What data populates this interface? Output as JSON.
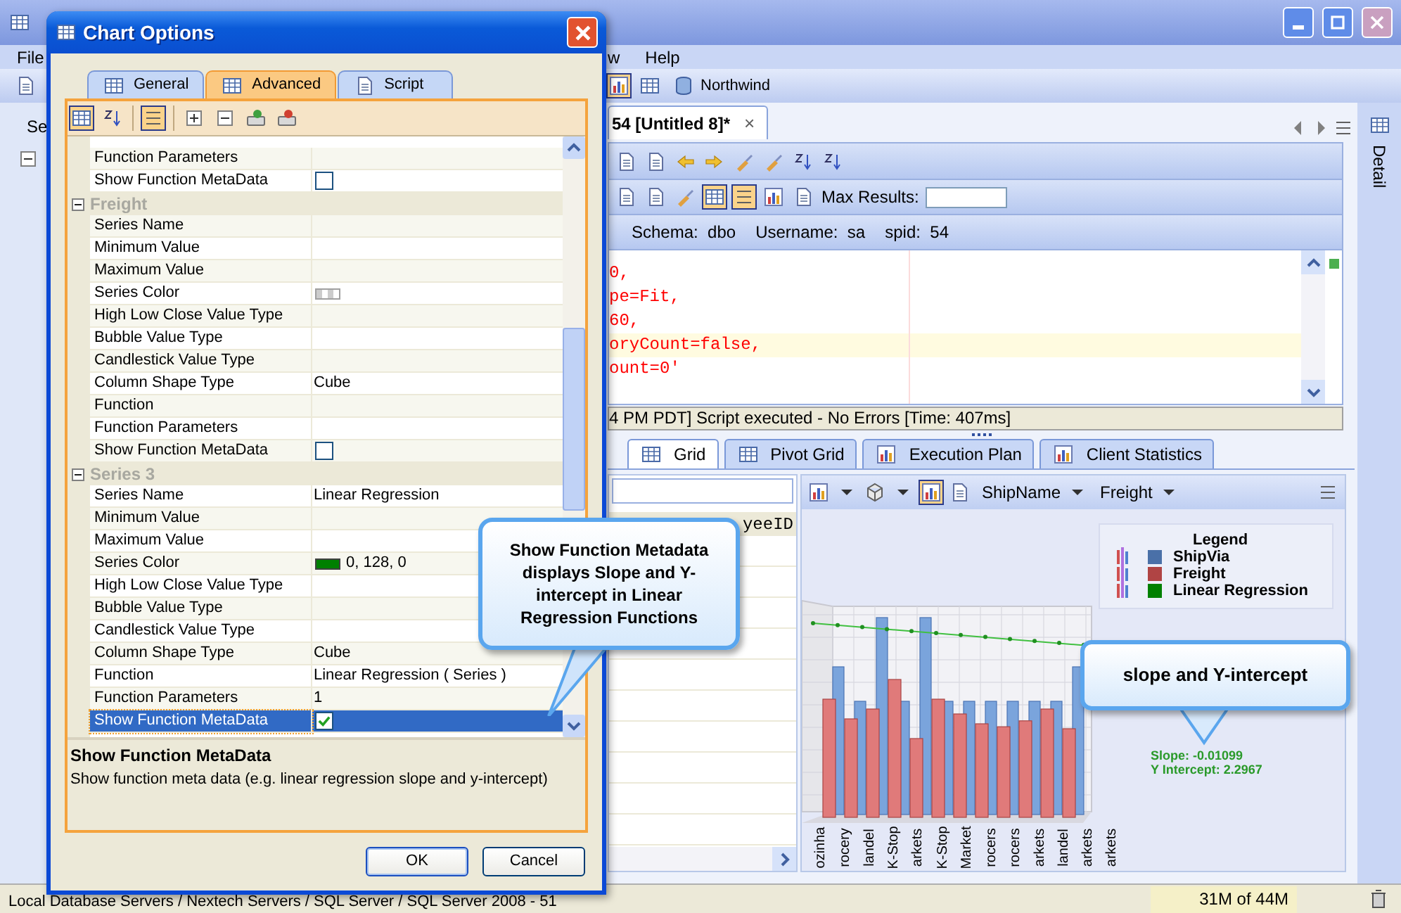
{
  "main_window": {
    "menu": [
      "File",
      "w",
      "Help"
    ],
    "connection": "Northwind",
    "side_panel": {
      "title": "Se"
    },
    "right_panel": {
      "title": "Detail"
    }
  },
  "editor": {
    "tab": {
      "label": "54 [Untitled 8]*",
      "close": "×"
    },
    "max_results": {
      "label": "Max Results:"
    },
    "info": [
      {
        "label": "Schema:",
        "value": "dbo"
      },
      {
        "label": "Username:",
        "value": "sa"
      },
      {
        "label": "spid:",
        "value": "54"
      }
    ],
    "code_lines": [
      {
        "text": "0,",
        "highlighted": false
      },
      {
        "text": "pe=Fit,",
        "highlighted": false
      },
      {
        "text": "60,",
        "highlighted": false
      },
      {
        "text": "oryCount=false,",
        "highlighted": true
      },
      {
        "text": "ount=0'",
        "highlighted": false
      }
    ],
    "status": "4 PM PDT] Script executed - No Errors [Time: 407ms]"
  },
  "results": {
    "tabs": [
      {
        "label": "Grid",
        "selected": true
      },
      {
        "label": "Pivot Grid",
        "selected": false
      },
      {
        "label": "Execution Plan",
        "selected": false
      },
      {
        "label": "Client Statistics",
        "selected": false
      }
    ],
    "grid": {
      "column": "yeeID"
    },
    "chart": {
      "category_field": "ShipName",
      "value_field": "Freight",
      "legend": {
        "title": "Legend",
        "items": [
          {
            "label": "ShipVia",
            "color": "#4a70a8"
          },
          {
            "label": "Freight",
            "color": "#b04444"
          },
          {
            "label": "Linear Regression",
            "color": "#008000"
          }
        ]
      },
      "metadata": [
        "Slope: -0.01099",
        "Y Intercept: 2.2967"
      ],
      "x_labels": [
        "ozinha",
        "rocery",
        "landel",
        "K-Stop",
        "arkets",
        "K-Stop",
        "Market",
        "rocers",
        "rocers",
        "arkets",
        "landel",
        "arkets",
        "arkets"
      ]
    }
  },
  "status_bar": {
    "path": "Local Database Servers / Nextech Servers / SQL Server / SQL Server 2008 - 51",
    "memory": "31M of 44M"
  },
  "dialog": {
    "title": "Chart Options",
    "tabs": [
      {
        "label": "General",
        "selected": false
      },
      {
        "label": "Advanced",
        "selected": true
      },
      {
        "label": "Script",
        "selected": false
      }
    ],
    "toolbar": [
      {
        "kind": "categorized",
        "selected": true
      },
      {
        "kind": "alphabetical",
        "selected": false
      },
      {
        "kind": "pages",
        "selected": true
      },
      {
        "kind": "expand",
        "selected": false
      },
      {
        "kind": "collapse",
        "selected": false
      },
      {
        "kind": "add",
        "selected": false
      },
      {
        "kind": "remove",
        "selected": false
      }
    ],
    "groups": [
      {
        "rows": [
          {
            "label": "Function Parameters",
            "kind": "text",
            "selected": false
          },
          {
            "label": "Show Function MetaData",
            "kind": "checkbox",
            "checked": false,
            "selected": false
          }
        ]
      },
      {
        "name": "Freight",
        "expanded": true,
        "rows": [
          {
            "label": "Series Name",
            "kind": "text",
            "selected": false
          },
          {
            "label": "Minimum Value",
            "kind": "text",
            "selected": false
          },
          {
            "label": "Maximum Value",
            "kind": "text",
            "selected": false
          },
          {
            "label": "Series Color",
            "kind": "swatch",
            "selected": false
          },
          {
            "label": "High Low Close Value Type",
            "kind": "text",
            "selected": false
          },
          {
            "label": "Bubble Value Type",
            "kind": "text",
            "selected": false
          },
          {
            "label": "Candlestick Value Type",
            "kind": "text",
            "selected": false
          },
          {
            "label": "Column Shape Type",
            "kind": "text",
            "value": "Cube",
            "selected": false
          },
          {
            "label": "Function",
            "kind": "text",
            "selected": false
          },
          {
            "label": "Function Parameters",
            "kind": "text",
            "selected": false
          },
          {
            "label": "Show Function MetaData",
            "kind": "checkbox",
            "checked": false,
            "selected": false
          }
        ]
      },
      {
        "name": "Series 3",
        "expanded": true,
        "rows": [
          {
            "label": "Series Name",
            "kind": "text",
            "value": "Linear Regression",
            "selected": false
          },
          {
            "label": "Minimum Value",
            "kind": "text",
            "selected": false
          },
          {
            "label": "Maximum Value",
            "kind": "text",
            "selected": false
          },
          {
            "label": "Series Color",
            "kind": "swatch",
            "color": "#008000",
            "value": "0, 128, 0",
            "selected": false
          },
          {
            "label": "High Low Close Value Type",
            "kind": "text",
            "selected": false
          },
          {
            "label": "Bubble Value Type",
            "kind": "text",
            "selected": false
          },
          {
            "label": "Candlestick Value Type",
            "kind": "text",
            "selected": false
          },
          {
            "label": "Column Shape Type",
            "kind": "text",
            "value": "Cube",
            "selected": false
          },
          {
            "label": "Function",
            "kind": "text",
            "value": "Linear Regression ( Series )",
            "selected": false
          },
          {
            "label": "Function Parameters",
            "kind": "text",
            "value": "1",
            "selected": false
          },
          {
            "label": "Show Function MetaData",
            "kind": "checkbox",
            "checked": true,
            "selected": true
          }
        ]
      }
    ],
    "description": {
      "title": "Show Function MetaData",
      "text": "Show function meta data (e.g. linear regression slope and y-intercept)"
    },
    "buttons": [
      "OK",
      "Cancel"
    ]
  },
  "callouts": [
    {
      "text": "Show Function Metadata displays Slope and Y-intercept in Linear Regression Functions"
    },
    {
      "text": "slope and Y-intercept"
    }
  ]
}
